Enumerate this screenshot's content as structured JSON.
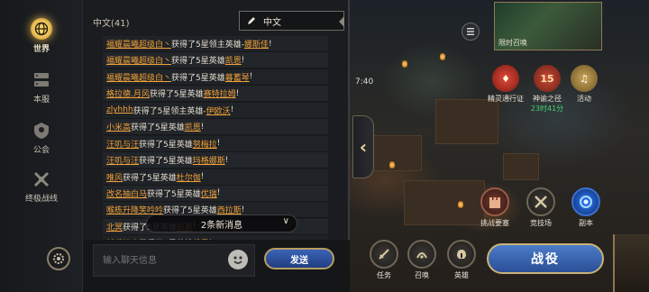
{
  "nav": {
    "items": [
      {
        "label": "世界",
        "icon": "globe-icon",
        "active": true
      },
      {
        "label": "本服",
        "icon": "server-icon",
        "active": false
      },
      {
        "label": "公会",
        "icon": "guild-icon",
        "active": false
      },
      {
        "label": "终极战线",
        "icon": "crossed-swords-icon",
        "active": false
      }
    ]
  },
  "chat": {
    "channel_title": "中文(41)",
    "channel_select": "中文",
    "messages": [
      {
        "who": "福耀晨曦超级白丶",
        "text": "获得了5星领主英雄-",
        "hero": "娜斯佳",
        "end": "!"
      },
      {
        "who": "福耀晨曦超级白丶",
        "text": "获得了5星英雄",
        "hero": "凯恩",
        "end": "!"
      },
      {
        "who": "福耀晨曦超级白丶",
        "text": "获得了5星英雄",
        "hero": "暮蓄琴",
        "end": "!"
      },
      {
        "who": "格拉德.月风",
        "text": "获得了5星英雄",
        "hero": "赛特拉姆",
        "end": "!"
      },
      {
        "who": "zlyhhh",
        "text": "获得了5星领主英雄-",
        "hero": "伊欧沃",
        "end": "!"
      },
      {
        "who": "小米高",
        "text": "获得了5星英雄",
        "hero": "凯恩",
        "end": "!"
      },
      {
        "who": "汪叽与汪",
        "text": "获得了5星英雄",
        "hero": "努梅拉",
        "end": "!"
      },
      {
        "who": "汪叽与汪",
        "text": "获得了5星英雄",
        "hero": "玛格娜斯",
        "end": "!"
      },
      {
        "who": "唯风",
        "text": "获得了5星英雄",
        "hero": "杜尔伽",
        "end": "!"
      },
      {
        "who": "改名抽白马",
        "text": "获得了5星英雄",
        "hero": "优瑞",
        "end": "!"
      },
      {
        "who": "喉栋升降笑吟吟",
        "text": "获得了5星英雄",
        "hero": "西拉斯",
        "end": "!"
      },
      {
        "who": "北冥",
        "text": "获得了5星英雄",
        "hero": "凯恩",
        "end": "!"
      },
      {
        "who": "就爱抽卡",
        "text": "获得了5星英雄",
        "hero": "凯恩",
        "end": "!"
      },
      {
        "who": "发牌员是",
        "text": "获得了5星英雄",
        "hero": "凯恩",
        "end": "!"
      }
    ],
    "new_messages": "2条新消息",
    "input_placeholder": "输入聊天信息",
    "send_label": "发送"
  },
  "hud": {
    "timer": "7:40",
    "summon_card_label": "限时召唤",
    "top_buttons": [
      {
        "label": "精灵通行证",
        "sub": ""
      },
      {
        "label": "神谕之径",
        "sub": "23时41分",
        "badge": "15"
      },
      {
        "label": "活动",
        "sub": ""
      }
    ],
    "mid_buttons": [
      {
        "label": "挑战要塞"
      },
      {
        "label": "竞技场"
      },
      {
        "label": "副本"
      }
    ],
    "bottom_buttons": [
      {
        "label": "任务"
      },
      {
        "label": "召唤"
      },
      {
        "label": "英雄"
      }
    ],
    "battle_label": "战役"
  },
  "colors": {
    "accent_gold": "#f0a23a",
    "send_blue": "#3a63b8",
    "highlight": "#f6d36a"
  }
}
